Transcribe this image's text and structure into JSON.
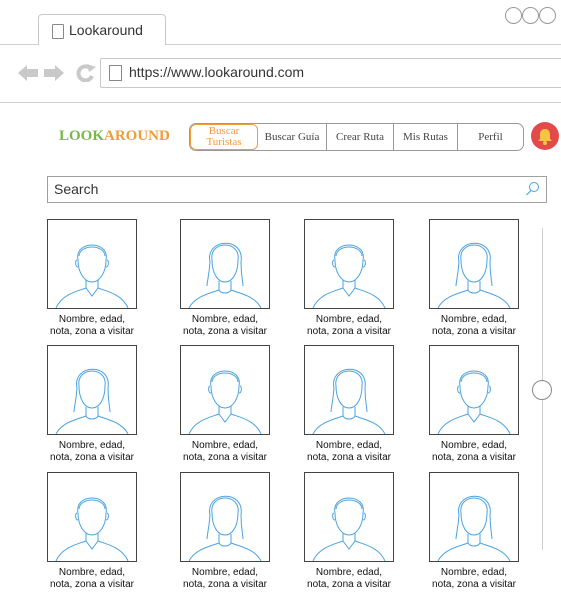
{
  "browser": {
    "tab_title": "Lookaround",
    "url": "https://www.lookaround.com"
  },
  "app": {
    "logo_part1": "LOOK",
    "logo_part2": "AROUND",
    "logo_color1": "#7ab648",
    "logo_color2": "#f29a3a",
    "nav": [
      {
        "label": "Buscar Turistas",
        "active": true
      },
      {
        "label": "Buscar Guía",
        "active": false
      },
      {
        "label": "Crear Ruta",
        "active": false
      },
      {
        "label": "Mis Rutas",
        "active": false
      },
      {
        "label": "Perfil",
        "active": false
      }
    ],
    "notification_icon": "bell-icon",
    "search_placeholder": "Search"
  },
  "results": {
    "caption_line1": "Nombre, edad,",
    "caption_line2": "nota, zona a visitar",
    "cards": [
      {
        "avatar": "male"
      },
      {
        "avatar": "female"
      },
      {
        "avatar": "male"
      },
      {
        "avatar": "female"
      },
      {
        "avatar": "female"
      },
      {
        "avatar": "male"
      },
      {
        "avatar": "female"
      },
      {
        "avatar": "male"
      },
      {
        "avatar": "male"
      },
      {
        "avatar": "female"
      },
      {
        "avatar": "male"
      },
      {
        "avatar": "female"
      }
    ]
  }
}
